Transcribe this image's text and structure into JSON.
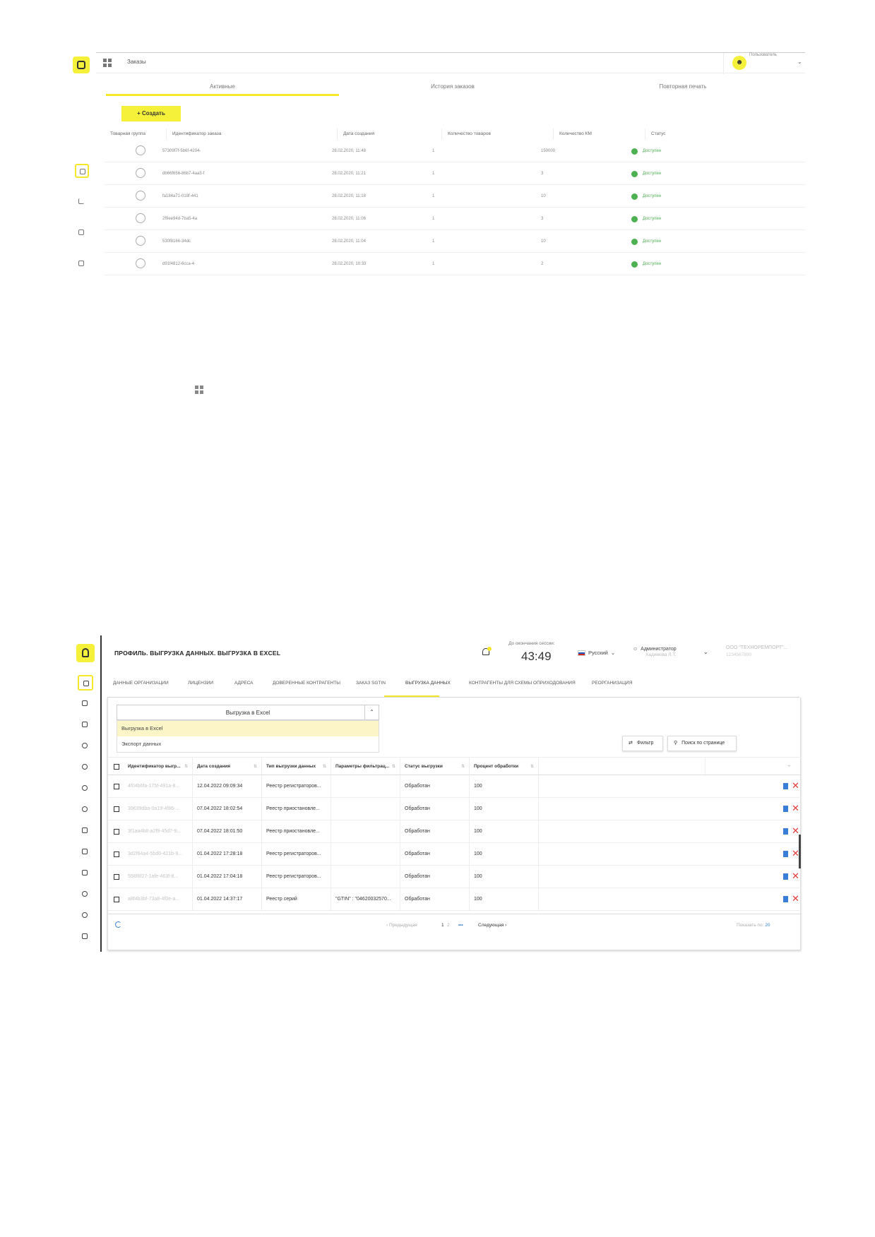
{
  "screen1": {
    "title": "Заказы",
    "user_label": "Пользователь",
    "tabs": [
      "Активные",
      "История заказов",
      "Повторная печать"
    ],
    "create_label": "+ Создать",
    "columns": [
      "Товарная группа",
      "Идентификатор заказа",
      "Дата создания",
      "Количество товаров",
      "Количество КМ",
      "Статус"
    ],
    "rows": [
      {
        "id": "57309f7f-5b6f-4204-",
        "date": "28.02.2020, 11:48",
        "qty": "1",
        "km": "150000",
        "status": "Доступен"
      },
      {
        "id": "db66f656-86b7-4aa3-f",
        "date": "28.02.2020, 11:21",
        "qty": "1",
        "km": "3",
        "status": "Доступен"
      },
      {
        "id": "fa184a71-018f-441",
        "date": "28.02.2020, 11:18",
        "qty": "1",
        "km": "10",
        "status": "Доступен"
      },
      {
        "id": "2f9ee94d-7ba5-4a",
        "date": "28.02.2020, 11:06",
        "qty": "1",
        "km": "3",
        "status": "Доступен"
      },
      {
        "id": "530f8166-34dc",
        "date": "28.02.2020, 11:04",
        "qty": "1",
        "km": "10",
        "status": "Доступен"
      },
      {
        "id": "d91f4812-6cca-4",
        "date": "28.02.2020, 10:33",
        "qty": "1",
        "km": "2",
        "status": "Доступен"
      }
    ]
  },
  "screen2": {
    "page_title": "ПРОФИЛЬ. ВЫГРУЗКА ДАННЫХ. ВЫГРУЗКА В EXCEL",
    "session_label": "До окончания сессии:",
    "session_time": "43:49",
    "language": "Русский",
    "admin_label": "Администратор",
    "admin_name": "Хадимова Л.Т.",
    "org_line1": "ООО \"ТЕХНОРЕМПОРТ\"...",
    "org_line2": "1234567890",
    "tabs": [
      "ДАННЫЕ ОРГАНИЗАЦИИ",
      "ЛИЦЕНЗИИ",
      "АДРЕСА",
      "ДОВЕРЕННЫЕ КОНТРАГЕНТЫ",
      "ЗАКАЗ SGTIN",
      "ВЫГРУЗКА ДАННЫХ",
      "КОНТРАГЕНТЫ ДЛЯ СХЕМЫ ОПРИХОДОВАНИЯ",
      "РЕОРГАНИЗАЦИЯ"
    ],
    "active_tab": "ВЫГРУЗКА ДАННЫХ",
    "select_value": "Выгрузка в Excel",
    "dropdown_options": [
      "Выгрузка в Excel",
      "Экспорт данных"
    ],
    "filter_label": "Фильтр",
    "search_label": "Поиск по странице",
    "columns": [
      "Идентификатор выгр...",
      "Дата создания",
      "Тип выгрузки данных",
      "Параметры фильтрац...",
      "Статус выгрузки",
      "Процент обработки"
    ],
    "add_column": "+",
    "rows": [
      {
        "id": "4f04b6fa-175f-491a-8...",
        "date": "12.04.2022 09:09:34",
        "type": "Реестр регистраторов...",
        "params": "",
        "status": "Обработан",
        "percent": "100"
      },
      {
        "id": "39639dba-0a19-4f86-...",
        "date": "07.04.2022 18:02:54",
        "type": "Реестр приостановле...",
        "params": "",
        "status": "Обработан",
        "percent": "100"
      },
      {
        "id": "3f1aa4b8-a2f9-45d7-9...",
        "date": "07.04.2022 18:01:50",
        "type": "Реестр приостановле...",
        "params": "",
        "status": "Обработан",
        "percent": "100"
      },
      {
        "id": "3d2f64a4-5bd0-421b-9...",
        "date": "01.04.2022 17:28:18",
        "type": "Реестр регистраторов...",
        "params": "",
        "status": "Обработан",
        "percent": "100"
      },
      {
        "id": "558f6f27-1afe-463f-8...",
        "date": "01.04.2022 17:04:18",
        "type": "Реестр регистраторов...",
        "params": "",
        "status": "Обработан",
        "percent": "100"
      },
      {
        "id": "a8f4b3bf-73a8-4f0e-a...",
        "date": "01.04.2022 14:37:17",
        "type": "Реестр серий",
        "params": "\"GTIN\" : \"04620032570...",
        "status": "Обработан",
        "percent": "100"
      }
    ],
    "pagination": {
      "prev": "Предыдущая",
      "current": "1",
      "next_page": "2",
      "ellipsis": "•••",
      "next": "Следующая",
      "show_label": "Показать по:",
      "show_count": "20"
    }
  },
  "colors": {
    "accent": "#f5f13a",
    "ok": "#4caf50",
    "danger": "#e53935",
    "doc": "#3a7fd5"
  }
}
